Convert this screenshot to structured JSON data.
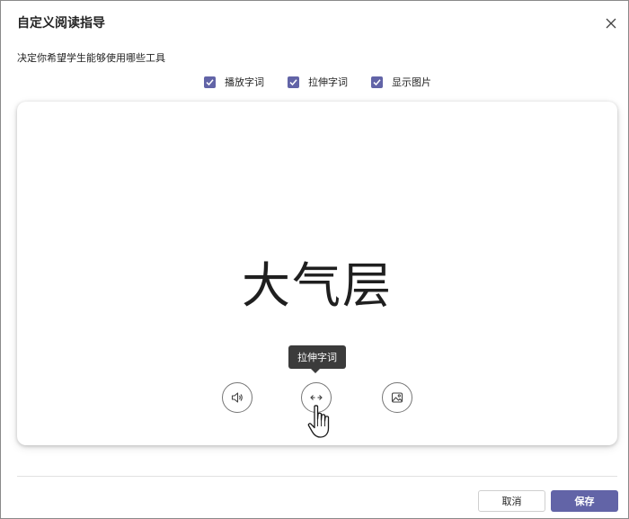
{
  "dialog": {
    "title": "自定义阅读指导",
    "close_icon": "close-icon"
  },
  "subtitle": "决定你希望学生能够使用哪些工具",
  "options": [
    {
      "label": "播放字词",
      "checked": true
    },
    {
      "label": "拉伸字词",
      "checked": true
    },
    {
      "label": "显示图片",
      "checked": true
    }
  ],
  "preview": {
    "word": "大气层",
    "tooltip": "拉伸字词",
    "tools": [
      {
        "icon": "speaker-icon"
      },
      {
        "icon": "stretch-icon"
      },
      {
        "icon": "image-icon"
      }
    ]
  },
  "footer": {
    "cancel_label": "取消",
    "save_label": "保存"
  },
  "colors": {
    "accent": "#6264a7",
    "tooltip_bg": "#3b3b3b"
  }
}
